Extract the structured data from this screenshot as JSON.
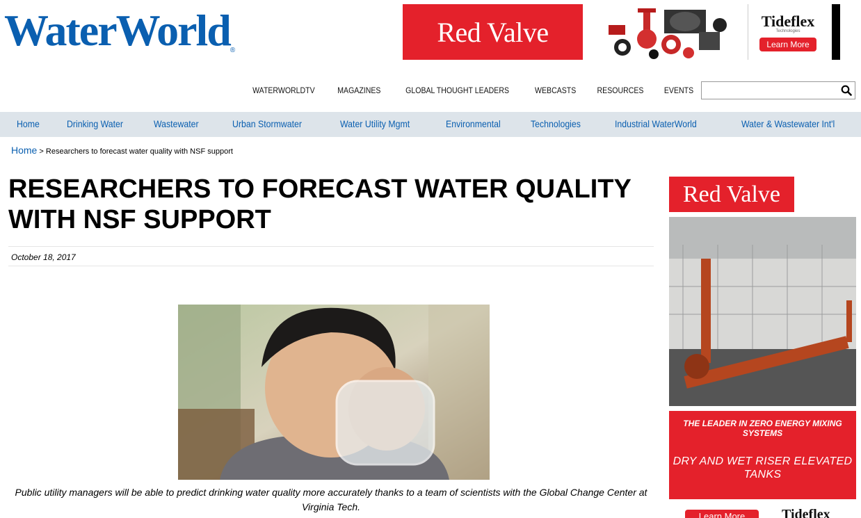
{
  "header": {
    "logo_text": "WaterWorld",
    "logo_reg": "®",
    "banner": {
      "brand": "Red Valve",
      "tideflex_logo": "Tideflex",
      "tideflex_sub": "Technologies",
      "learn_more": "Learn More"
    }
  },
  "utility_nav": {
    "items": [
      "WATERWORLDTV",
      "MAGAZINES",
      "GLOBAL THOUGHT LEADERS",
      "WEBCASTS",
      "RESOURCES",
      "EVENTS"
    ],
    "search_placeholder": ""
  },
  "main_nav": {
    "items": [
      "Home",
      "Drinking Water",
      "Wastewater",
      "Urban Stormwater",
      "Water Utility Mgmt",
      "Environmental",
      "Technologies",
      "Industrial WaterWorld",
      "Water & Wastewater Int'l"
    ]
  },
  "breadcrumb": {
    "home": "Home",
    "separator": ">",
    "current": "Researchers to forecast water quality with NSF support"
  },
  "article": {
    "title": "RESEARCHERS TO FORECAST WATER QUALITY WITH NSF SUPPORT",
    "date": "October 18, 2017",
    "caption": "Public utility managers will be able to predict drinking water quality more accurately thanks to a team of scientists with the Global Change Center at Virginia Tech."
  },
  "sidebar_ad": {
    "brand": "Red Valve",
    "line1": "THE LEADER IN ZERO ENERGY MIXING SYSTEMS",
    "line2": "DRY AND WET RISER ELEVATED TANKS",
    "learn_more": "Learn More",
    "tideflex_logo": "Tideflex"
  },
  "colors": {
    "brand_blue": "#0a5fb0",
    "ad_red": "#e4212b",
    "nav_bg": "#dde4ea"
  }
}
